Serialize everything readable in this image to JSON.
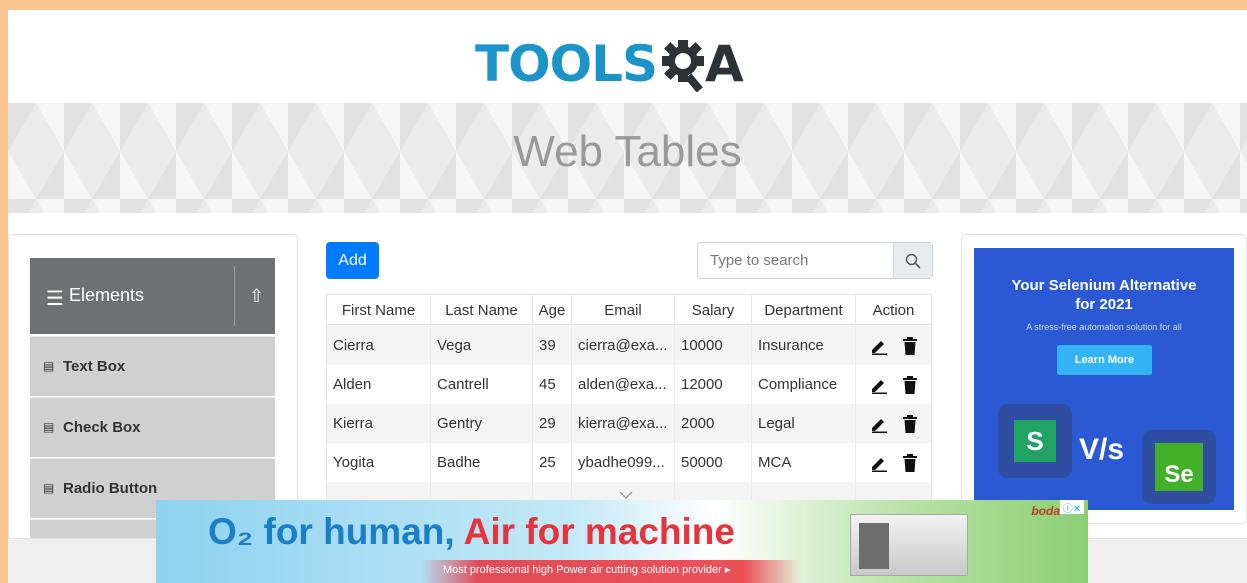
{
  "header": {
    "logo_main": "TOOLS",
    "logo_tail": "A"
  },
  "banner": {
    "title": "Web Tables"
  },
  "sidebar": {
    "group_label": "Elements",
    "items": [
      {
        "label": "Text Box"
      },
      {
        "label": "Check Box"
      },
      {
        "label": "Radio Button"
      }
    ]
  },
  "toolbar": {
    "add_label": "Add",
    "search_placeholder": "Type to search"
  },
  "table": {
    "headers": [
      "First Name",
      "Last Name",
      "Age",
      "Email",
      "Salary",
      "Department",
      "Action"
    ],
    "rows": [
      [
        "Cierra",
        "Vega",
        "39",
        "cierra@exa...",
        "10000",
        "Insurance"
      ],
      [
        "Alden",
        "Cantrell",
        "45",
        "alden@exa...",
        "12000",
        "Compliance"
      ],
      [
        "Kierra",
        "Gentry",
        "29",
        "kierra@exa...",
        "2000",
        "Legal"
      ],
      [
        "Yogita",
        "Badhe",
        "25",
        "ybadhe099...",
        "50000",
        "MCA"
      ]
    ]
  },
  "side_ad": {
    "title_line1": "Your Selenium Alternative",
    "title_line2": "for 2021",
    "subtitle": "A stress-free automation solution for all",
    "button_label": "Learn More",
    "vs_text": "V/s",
    "left_logo": "S",
    "right_logo": "Se"
  },
  "bottom_ad": {
    "o2": "O₂ for human,",
    "air": "Air for machine",
    "tagline": "Most professional high Power air cutting solution provider ▸",
    "brand": "boda"
  },
  "colors": {
    "accent": "#007bff",
    "logo_blue": "#1a94c9",
    "sidebar_header": "#6e7174",
    "sidebar_item": "#d0d0d0",
    "page_border": "#f9c48f",
    "ad_blue": "#2a59d3"
  }
}
